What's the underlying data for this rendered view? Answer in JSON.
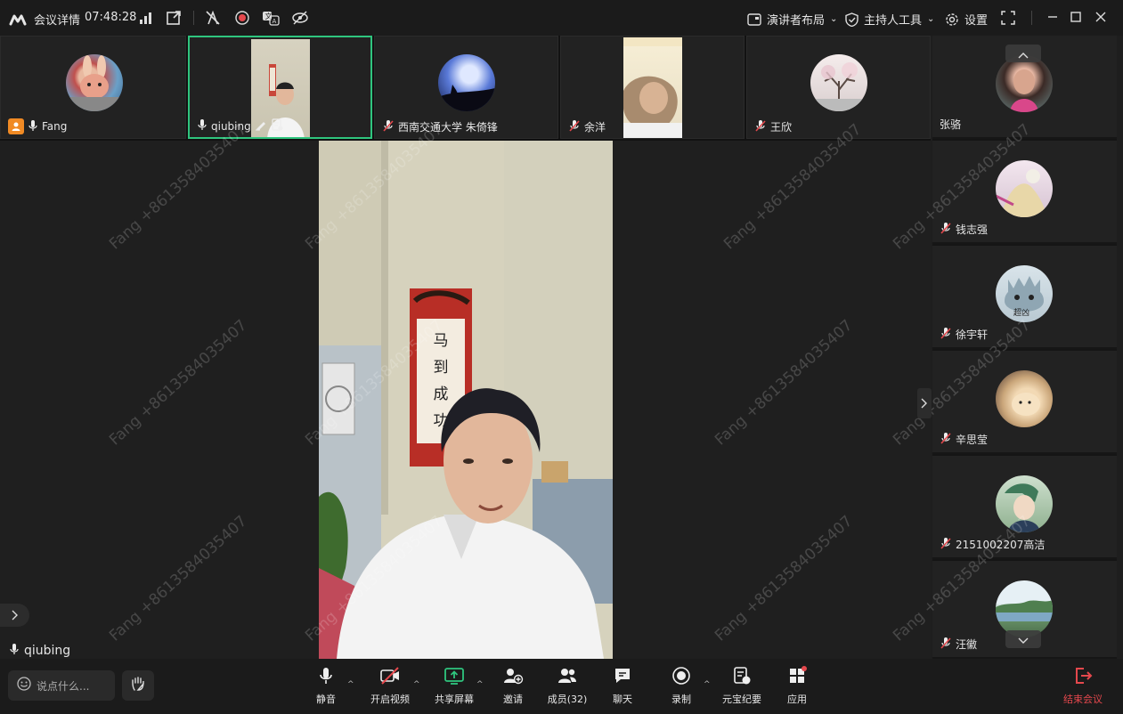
{
  "title_bar": {
    "meeting_details": "会议详情",
    "time": "07:48:28",
    "layout": "演讲者布局",
    "host_tools": "主持人工具",
    "settings": "设置"
  },
  "top_tiles": [
    {
      "name": "Fang"
    },
    {
      "name": "qiubing"
    },
    {
      "name": "西南交通大学 朱倚锋"
    },
    {
      "name": "余洋"
    },
    {
      "name": "王欣"
    }
  ],
  "right_tiles": [
    {
      "name": "张骆"
    },
    {
      "name": "钱志强"
    },
    {
      "name": "徐宇轩",
      "avatar_text": "超凶"
    },
    {
      "name": "辛思莹"
    },
    {
      "name": "2151002207高洁"
    },
    {
      "name": "汪徽"
    }
  ],
  "speaker": {
    "name": "qiubing"
  },
  "video": {
    "scroll_text": "马到成功"
  },
  "watermark": "Fang +8613584035407",
  "chat_input": {
    "placeholder": "说点什么..."
  },
  "toolbar": {
    "mute": "静音",
    "video": "开启视频",
    "share": "共享屏幕",
    "invite": "邀请",
    "members": "成员(32)",
    "chat": "聊天",
    "record": "录制",
    "minutes": "元宝纪要",
    "apps": "应用",
    "end": "结束会议"
  },
  "colors": {
    "accent_green": "#2fc57e",
    "end_red": "#e5484d",
    "mute_red": "#e5484d",
    "host_badge": "#f08a24"
  }
}
